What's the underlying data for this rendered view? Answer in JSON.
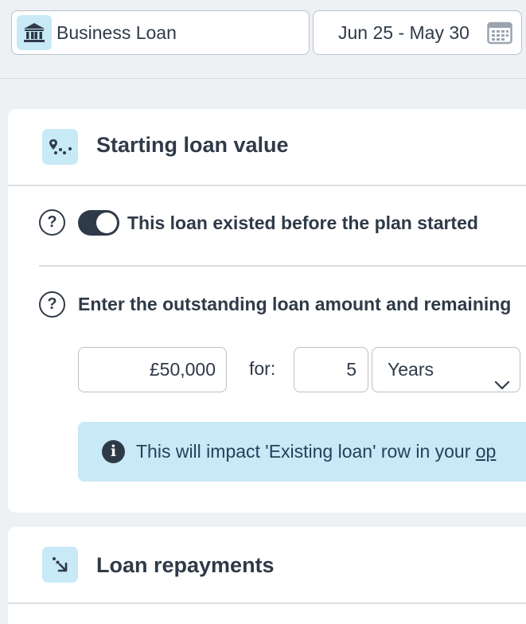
{
  "header": {
    "loan_name": "Business Loan",
    "date_range": "Jun 25 - May 30"
  },
  "starting_loan": {
    "title": "Starting loan value",
    "help_symbol": "?",
    "toggle_label": "This loan existed before the plan started",
    "toggle_on": true,
    "prompt": "Enter the outstanding loan amount and remaining",
    "amount_value": "£50,000",
    "for_label": "for:",
    "term_value": "5",
    "term_unit": "Years",
    "info_text_prefix": "This will impact 'Existing loan' row in your ",
    "info_link_text": "op"
  },
  "repayments": {
    "title": "Loan repayments"
  },
  "colors": {
    "dark": "#2f3a48",
    "accent_light": "#c8e9f6",
    "background": "#eef1f4"
  }
}
